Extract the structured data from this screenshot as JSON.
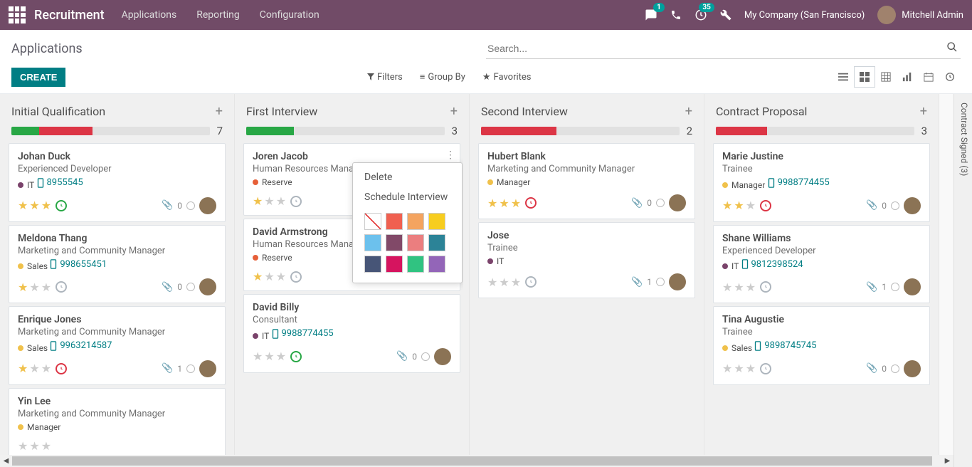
{
  "nav": {
    "brand": "Recruitment",
    "menu": [
      "Applications",
      "Reporting",
      "Configuration"
    ],
    "msg_badge": "1",
    "activity_badge": "35",
    "company": "My Company (San Francisco)",
    "user": "Mitchell Admin"
  },
  "cp": {
    "title": "Applications",
    "search_placeholder": "Search...",
    "create": "CREATE",
    "filters": "Filters",
    "groupby": "Group By",
    "favorites": "Favorites"
  },
  "cols": [
    {
      "title": "Initial Qualification",
      "count": "7",
      "progress": [
        [
          "green",
          "14%"
        ],
        [
          "red",
          "27%"
        ]
      ],
      "cards": [
        {
          "name": "Johan Duck",
          "sub": "Experienced Developer",
          "tag": "IT",
          "tagcolor": "#7a436b",
          "phone": "8955545",
          "stars": 3,
          "act": "green",
          "att": "0"
        },
        {
          "name": "Meldona Thang",
          "sub": "Marketing and Community Manager",
          "tag": "Sales",
          "tagcolor": "#f0c14b",
          "phone": "998655451",
          "stars": 1,
          "act": "grey",
          "att": "0"
        },
        {
          "name": "Enrique Jones",
          "sub": "Marketing and Community Manager",
          "tag": "Sales",
          "tagcolor": "#f0c14b",
          "phone": "9963214587",
          "stars": 1,
          "act": "red",
          "att": "1"
        },
        {
          "name": "Yin Lee",
          "sub": "Marketing and Community Manager",
          "tag": "Manager",
          "tagcolor": "#f0c14b",
          "phone": "",
          "stars": 0,
          "act": "",
          "att": ""
        }
      ]
    },
    {
      "title": "First Interview",
      "count": "3",
      "progress": [
        [
          "green",
          "24%"
        ]
      ],
      "cards": [
        {
          "name": "Joren Jacob",
          "sub": "Human Resources Manager",
          "tag": "Reserve",
          "tagcolor": "#e65f38",
          "phone": "",
          "stars": 1,
          "act": "grey",
          "att": "",
          "menu": true
        },
        {
          "name": "David Armstrong",
          "sub": "Human Resources Manager",
          "tag": "Reserve",
          "tagcolor": "#e65f38",
          "phone": "",
          "stars": 1,
          "act": "grey",
          "att": ""
        },
        {
          "name": "David Billy",
          "sub": "Consultant",
          "tag": "IT",
          "tagcolor": "#7a436b",
          "phone": "9988774455",
          "stars": 0,
          "act": "green",
          "att": "0"
        }
      ]
    },
    {
      "title": "Second Interview",
      "count": "2",
      "progress": [
        [
          "red",
          "38%"
        ]
      ],
      "cards": [
        {
          "name": "Hubert Blank",
          "sub": "Marketing and Community Manager",
          "tag": "Manager",
          "tagcolor": "#f0c14b",
          "phone": "",
          "stars": 3,
          "act": "red",
          "att": "0"
        },
        {
          "name": "Jose",
          "sub": "Trainee",
          "tag": "IT",
          "tagcolor": "#7a436b",
          "phone": "",
          "stars": 0,
          "act": "grey",
          "att": "1"
        }
      ]
    },
    {
      "title": "Contract Proposal",
      "count": "3",
      "progress": [
        [
          "red",
          "26%"
        ]
      ],
      "cards": [
        {
          "name": "Marie Justine",
          "sub": "Trainee",
          "tag": "Manager",
          "tagcolor": "#f0c14b",
          "phone": "9988774455",
          "stars": 2,
          "act": "red",
          "att": "0"
        },
        {
          "name": "Shane Williams",
          "sub": "Experienced Developer",
          "tag": "IT",
          "tagcolor": "#7a436b",
          "phone": "9812398524",
          "stars": 0,
          "act": "grey",
          "att": "1"
        },
        {
          "name": "Tina Augustie",
          "sub": "Trainee",
          "tag": "Sales",
          "tagcolor": "#f0c14b",
          "phone": "9898745745",
          "stars": 0,
          "act": "grey",
          "att": "0"
        }
      ]
    }
  ],
  "dropdown": {
    "delete": "Delete",
    "schedule": "Schedule Interview",
    "colors": [
      "none",
      "#f06050",
      "#f4a460",
      "#f7cd1f",
      "#6cc1ed",
      "#814968",
      "#eb7e7f",
      "#2c8397",
      "#475577",
      "#d6145f",
      "#30c381",
      "#9365b8"
    ]
  },
  "side_tab": "Contract Signed (3)"
}
